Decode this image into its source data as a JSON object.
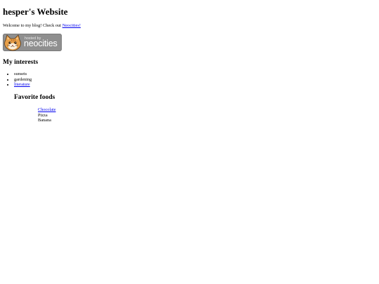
{
  "header": {
    "title": "hesper's Website"
  },
  "intro": {
    "text": "Welcome to my blog! Check out ",
    "link_text": "Neocities!"
  },
  "badge": {
    "small_text": "hosted by",
    "big_text": "neocities",
    "icon": "neocities-cat-logo",
    "colors": {
      "background": "#8f8f8f",
      "cat": "#e8a04a"
    }
  },
  "interests": {
    "title": "My interests",
    "items": [
      "sunsets",
      "gardening",
      "literature"
    ]
  },
  "foods": {
    "title": "Favorite foods",
    "items": [
      "Chocolate",
      "Pizza",
      "Banana"
    ]
  },
  "colors": {
    "link": "#0000ee",
    "text": "#000000",
    "background": "#ffffff"
  }
}
